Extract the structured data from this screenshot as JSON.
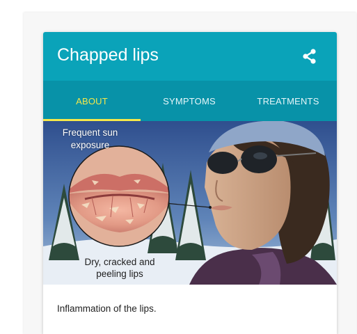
{
  "card": {
    "title": "Chapped lips",
    "share_icon": "share-icon",
    "accent_color": "#0aa3b9",
    "tabs": [
      {
        "label": "ABOUT",
        "active": true
      },
      {
        "label": "SYMPTOMS",
        "active": false
      },
      {
        "label": "TREATMENTS",
        "active": false
      }
    ],
    "illustration": {
      "label_top": "Frequent sun exposure",
      "label_bottom": "Dry, cracked and peeling lips"
    },
    "description": "Inflammation of the lips."
  }
}
